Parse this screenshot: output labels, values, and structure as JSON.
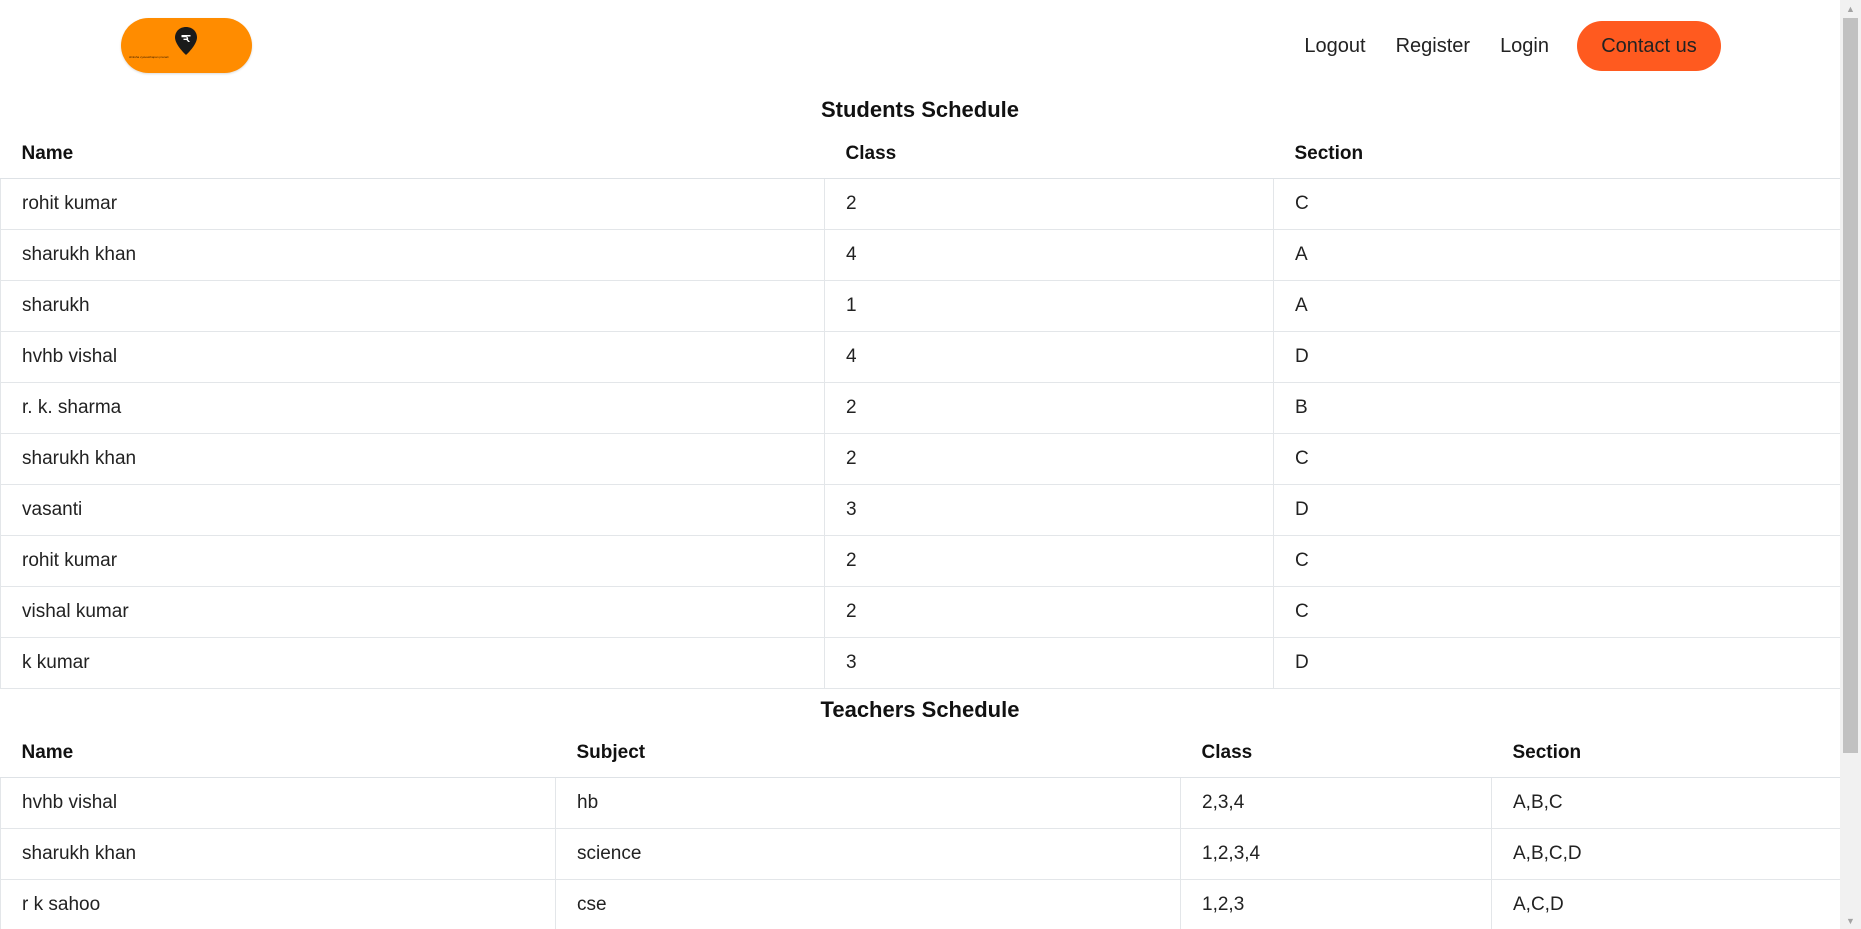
{
  "header": {
    "logo_text": "shiksha vyavasthapan pranali",
    "nav": {
      "logout": "Logout",
      "register": "Register",
      "login": "Login",
      "contact": "Contact us"
    }
  },
  "colors": {
    "logo_bg": "#ff8c00",
    "contact_bg": "#ff5a1f"
  },
  "students": {
    "title": "Students Schedule",
    "columns": [
      "Name",
      "Class",
      "Section"
    ],
    "rows": [
      [
        "rohit kumar",
        "2",
        "C"
      ],
      [
        "sharukh khan",
        "4",
        "A"
      ],
      [
        "sharukh",
        "1",
        "A"
      ],
      [
        "hvhb vishal",
        "4",
        "D"
      ],
      [
        "r. k. sharma",
        "2",
        "B"
      ],
      [
        "sharukh khan",
        "2",
        "C"
      ],
      [
        "vasanti",
        "3",
        "D"
      ],
      [
        "rohit kumar",
        "2",
        "C"
      ],
      [
        "vishal kumar",
        "2",
        "C"
      ],
      [
        "k kumar",
        "3",
        "D"
      ]
    ]
  },
  "teachers": {
    "title": "Teachers Schedule",
    "columns": [
      "Name",
      "Subject",
      "Class",
      "Section"
    ],
    "rows": [
      [
        "hvhb vishal",
        "hb",
        "2,3,4",
        "A,B,C"
      ],
      [
        "sharukh khan",
        "science",
        "1,2,3,4",
        "A,B,C,D"
      ],
      [
        "r k sahoo",
        "cse",
        "1,2,3",
        "A,C,D"
      ]
    ]
  },
  "scrollbar": {
    "up_icon": "triangle-up-icon",
    "down_icon": "triangle-down-icon"
  }
}
